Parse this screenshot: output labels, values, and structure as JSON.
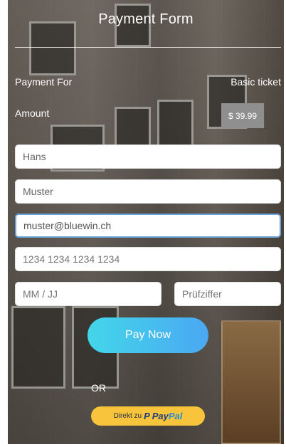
{
  "header": {
    "title": "Payment Form"
  },
  "summary": {
    "payment_for_label": "Payment For",
    "payment_for_value": "Basic ticket",
    "amount_label": "Amount",
    "amount_value": "$ 39.99"
  },
  "form": {
    "first_name": {
      "value": "Hans"
    },
    "last_name": {
      "value": "Muster"
    },
    "email": {
      "value": "muster@bluewin.ch"
    },
    "card_number": {
      "placeholder": "1234 1234 1234 1234"
    },
    "expiry": {
      "placeholder": "MM / JJ"
    },
    "cvc": {
      "placeholder": "Prüfziffer"
    },
    "pay_button_label": "Pay Now"
  },
  "alt": {
    "or_label": "OR",
    "paypal_prefix": "Direkt zu",
    "paypal_icon": "P",
    "paypal_brand_pay": "Pay",
    "paypal_brand_pal": "Pal"
  },
  "colors": {
    "pay_gradient_start": "#43d6ea",
    "pay_gradient_end": "#4aa8f2",
    "paypal_button": "#f7c43c",
    "price_box": "#8f8f8f",
    "focus_border": "#6aa3d8"
  }
}
